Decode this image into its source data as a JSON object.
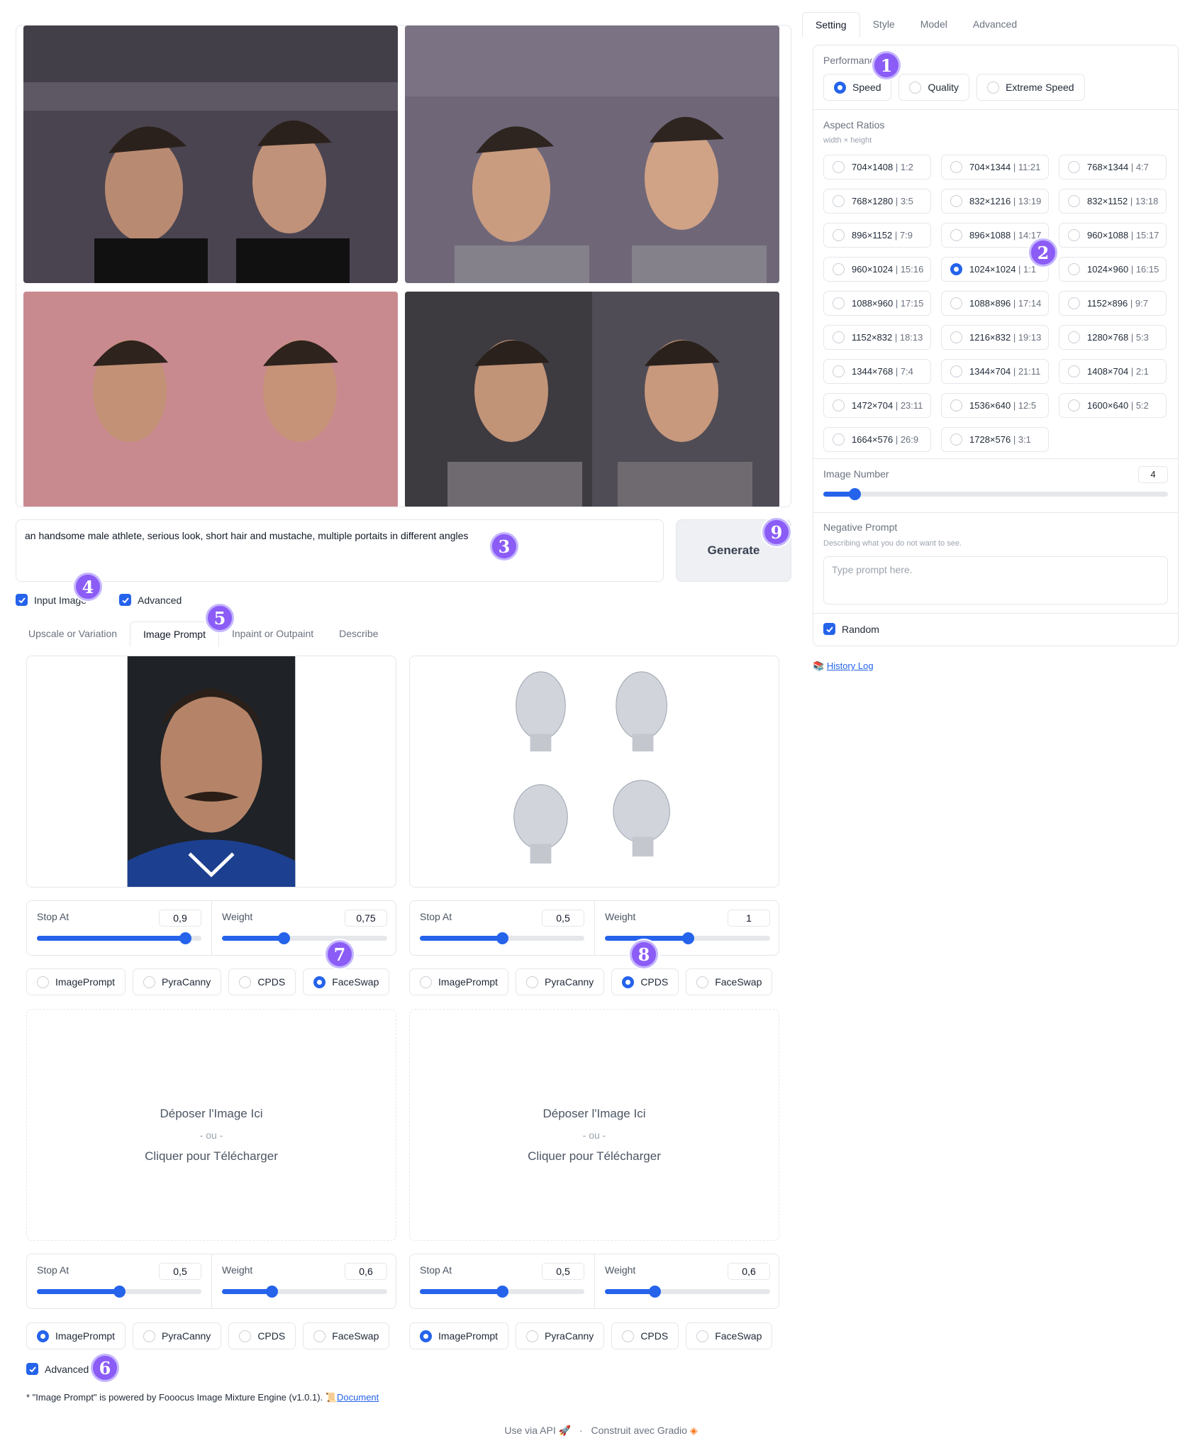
{
  "prompt": {
    "text": "an handsome male athlete, serious look, short hair and mustache, multiple portaits in different angles"
  },
  "generate_label": "Generate",
  "checkboxes": {
    "input_image": "Input Image",
    "advanced": "Advanced"
  },
  "input_tabs": [
    "Upscale or Variation",
    "Image Prompt",
    "Inpaint or Outpaint",
    "Describe"
  ],
  "image_prompt_slots": [
    {
      "stop_at": "0,9",
      "stop_at_value": 0.9,
      "weight": "0,75",
      "weight_value": 0.375,
      "selected": "FaceSwap"
    },
    {
      "stop_at": "0,5",
      "stop_at_value": 0.5,
      "weight": "1",
      "weight_value": 0.5,
      "selected": "CPDS"
    },
    {
      "stop_at": "0,5",
      "stop_at_value": 0.5,
      "weight": "0,6",
      "weight_value": 0.3,
      "selected": "ImagePrompt"
    },
    {
      "stop_at": "0,5",
      "stop_at_value": 0.5,
      "weight": "0,6",
      "weight_value": 0.3,
      "selected": "ImagePrompt"
    }
  ],
  "slider_labels": {
    "stop_at": "Stop At",
    "weight": "Weight"
  },
  "ip_types": [
    "ImagePrompt",
    "PyraCanny",
    "CPDS",
    "FaceSwap"
  ],
  "drop_zone": {
    "line1": "Déposer l'Image Ici",
    "line2": "- ou -",
    "line3": "Cliquer pour Télécharger"
  },
  "advanced_bottom": "Advanced",
  "note": {
    "text": "* \"Image Prompt\" is powered by Fooocus Image Mixture Engine (v1.0.1).",
    "link_icon": "scroll-icon",
    "link": "Document"
  },
  "settings_tabs": [
    "Setting",
    "Style",
    "Model",
    "Advanced"
  ],
  "performance": {
    "label": "Performance",
    "options": [
      "Speed",
      "Quality",
      "Extreme Speed"
    ],
    "selected": "Speed"
  },
  "aspect_ratios": {
    "label": "Aspect Ratios",
    "sublabel": "width × height",
    "selected": "1024×1024",
    "options": [
      {
        "size": "704×1408",
        "ratio": "1:2"
      },
      {
        "size": "704×1344",
        "ratio": "11:21"
      },
      {
        "size": "768×1344",
        "ratio": "4:7"
      },
      {
        "size": "768×1280",
        "ratio": "3:5"
      },
      {
        "size": "832×1216",
        "ratio": "13:19"
      },
      {
        "size": "832×1152",
        "ratio": "13:18"
      },
      {
        "size": "896×1152",
        "ratio": "7:9"
      },
      {
        "size": "896×1088",
        "ratio": "14:17"
      },
      {
        "size": "960×1088",
        "ratio": "15:17"
      },
      {
        "size": "960×1024",
        "ratio": "15:16"
      },
      {
        "size": "1024×1024",
        "ratio": "1:1"
      },
      {
        "size": "1024×960",
        "ratio": "16:15"
      },
      {
        "size": "1088×960",
        "ratio": "17:15"
      },
      {
        "size": "1088×896",
        "ratio": "17:14"
      },
      {
        "size": "1152×896",
        "ratio": "9:7"
      },
      {
        "size": "1152×832",
        "ratio": "18:13"
      },
      {
        "size": "1216×832",
        "ratio": "19:13"
      },
      {
        "size": "1280×768",
        "ratio": "5:3"
      },
      {
        "size": "1344×768",
        "ratio": "7:4"
      },
      {
        "size": "1344×704",
        "ratio": "21:11"
      },
      {
        "size": "1408×704",
        "ratio": "2:1"
      },
      {
        "size": "1472×704",
        "ratio": "23:11"
      },
      {
        "size": "1536×640",
        "ratio": "12:5"
      },
      {
        "size": "1600×640",
        "ratio": "5:2"
      },
      {
        "size": "1664×576",
        "ratio": "26:9"
      },
      {
        "size": "1728×576",
        "ratio": "3:1"
      }
    ]
  },
  "image_number": {
    "label": "Image Number",
    "value": "4",
    "fraction": 0.09
  },
  "negative_prompt": {
    "label": "Negative Prompt",
    "sublabel": "Describing what you do not want to see.",
    "placeholder": "Type prompt here."
  },
  "random_label": "Random",
  "history_log": {
    "icon": "books-icon",
    "label": "History Log"
  },
  "footer": {
    "api": "Use via API",
    "sep": "·",
    "built": "Construit avec Gradio"
  },
  "badges": [
    "1",
    "2",
    "3",
    "4",
    "5",
    "6",
    "7",
    "8",
    "9"
  ],
  "colors": {
    "accent": "#2563eb",
    "badge": "#8b5cf6"
  }
}
